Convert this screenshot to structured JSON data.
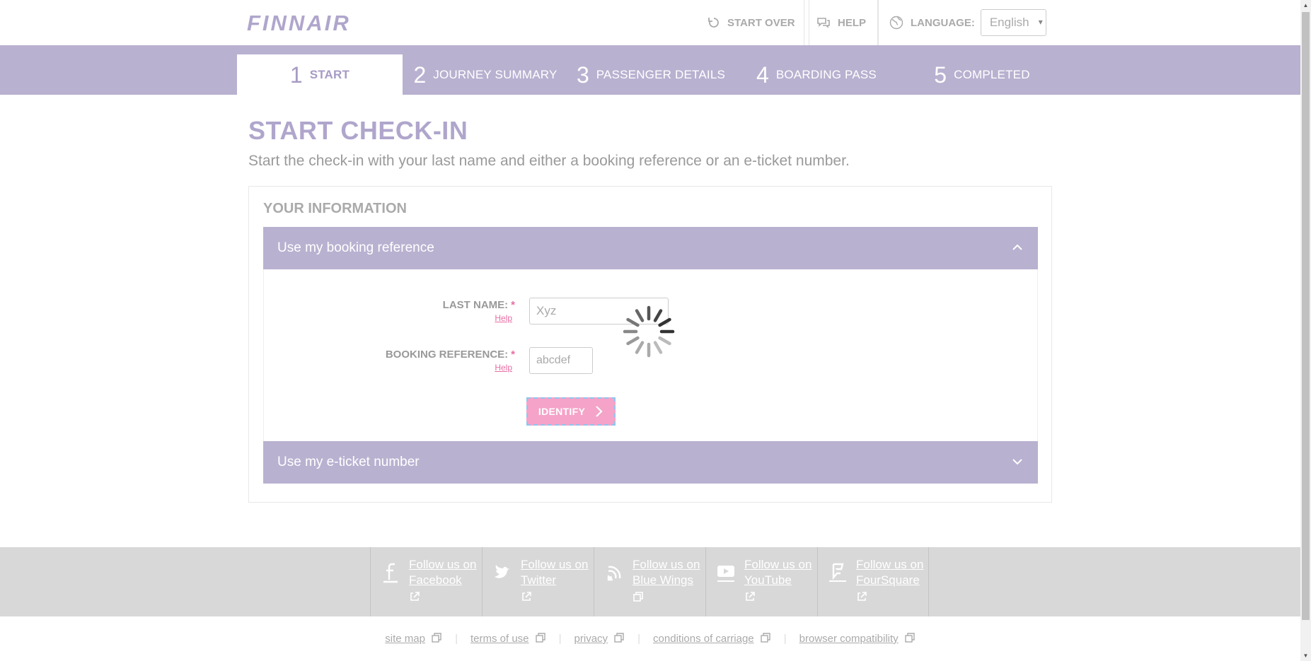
{
  "header": {
    "logo_text": "FINNAIR",
    "start_over": "START OVER",
    "help": "HELP",
    "language_label": "LANGUAGE:",
    "language_value": "English"
  },
  "steps": [
    {
      "num": "1",
      "label": "START",
      "active": true
    },
    {
      "num": "2",
      "label": "JOURNEY SUMMARY",
      "active": false
    },
    {
      "num": "3",
      "label": "PASSENGER DETAILS",
      "active": false
    },
    {
      "num": "4",
      "label": "BOARDING PASS",
      "active": false
    },
    {
      "num": "5",
      "label": "COMPLETED",
      "active": false
    }
  ],
  "main": {
    "title": "START CHECK-IN",
    "subtitle": "Start the check-in with your last name and either a booking reference or an e-ticket number.",
    "panel_title": "YOUR INFORMATION",
    "booking_accordion": "Use my booking reference",
    "eticket_accordion": "Use my e-ticket number",
    "last_name_label": "LAST NAME:",
    "last_name_value": "Xyz",
    "booking_ref_label": "BOOKING REFERENCE:",
    "booking_ref_value": "abcdef",
    "required_mark": "*",
    "help_link": "Help",
    "identify_button": "IDENTIFY"
  },
  "social": [
    {
      "icon": "facebook-icon",
      "line1": "Follow us on",
      "line2": "Facebook"
    },
    {
      "icon": "twitter-icon",
      "line1": "Follow us on",
      "line2": "Twitter"
    },
    {
      "icon": "bluewings-icon",
      "line1": "Follow us on",
      "line2": "Blue Wings"
    },
    {
      "icon": "youtube-icon",
      "line1": "Follow us on",
      "line2": "YouTube"
    },
    {
      "icon": "foursquare-icon",
      "line1": "Follow us on",
      "line2": "FourSquare"
    }
  ],
  "footer_links": [
    "site map",
    "terms of use",
    "privacy",
    "conditions of carriage",
    "browser compatibility"
  ],
  "colors": {
    "brand_purple": "#b9b1d0",
    "accent_pink": "#e86ea3",
    "button_pink": "#f5a3c9"
  }
}
